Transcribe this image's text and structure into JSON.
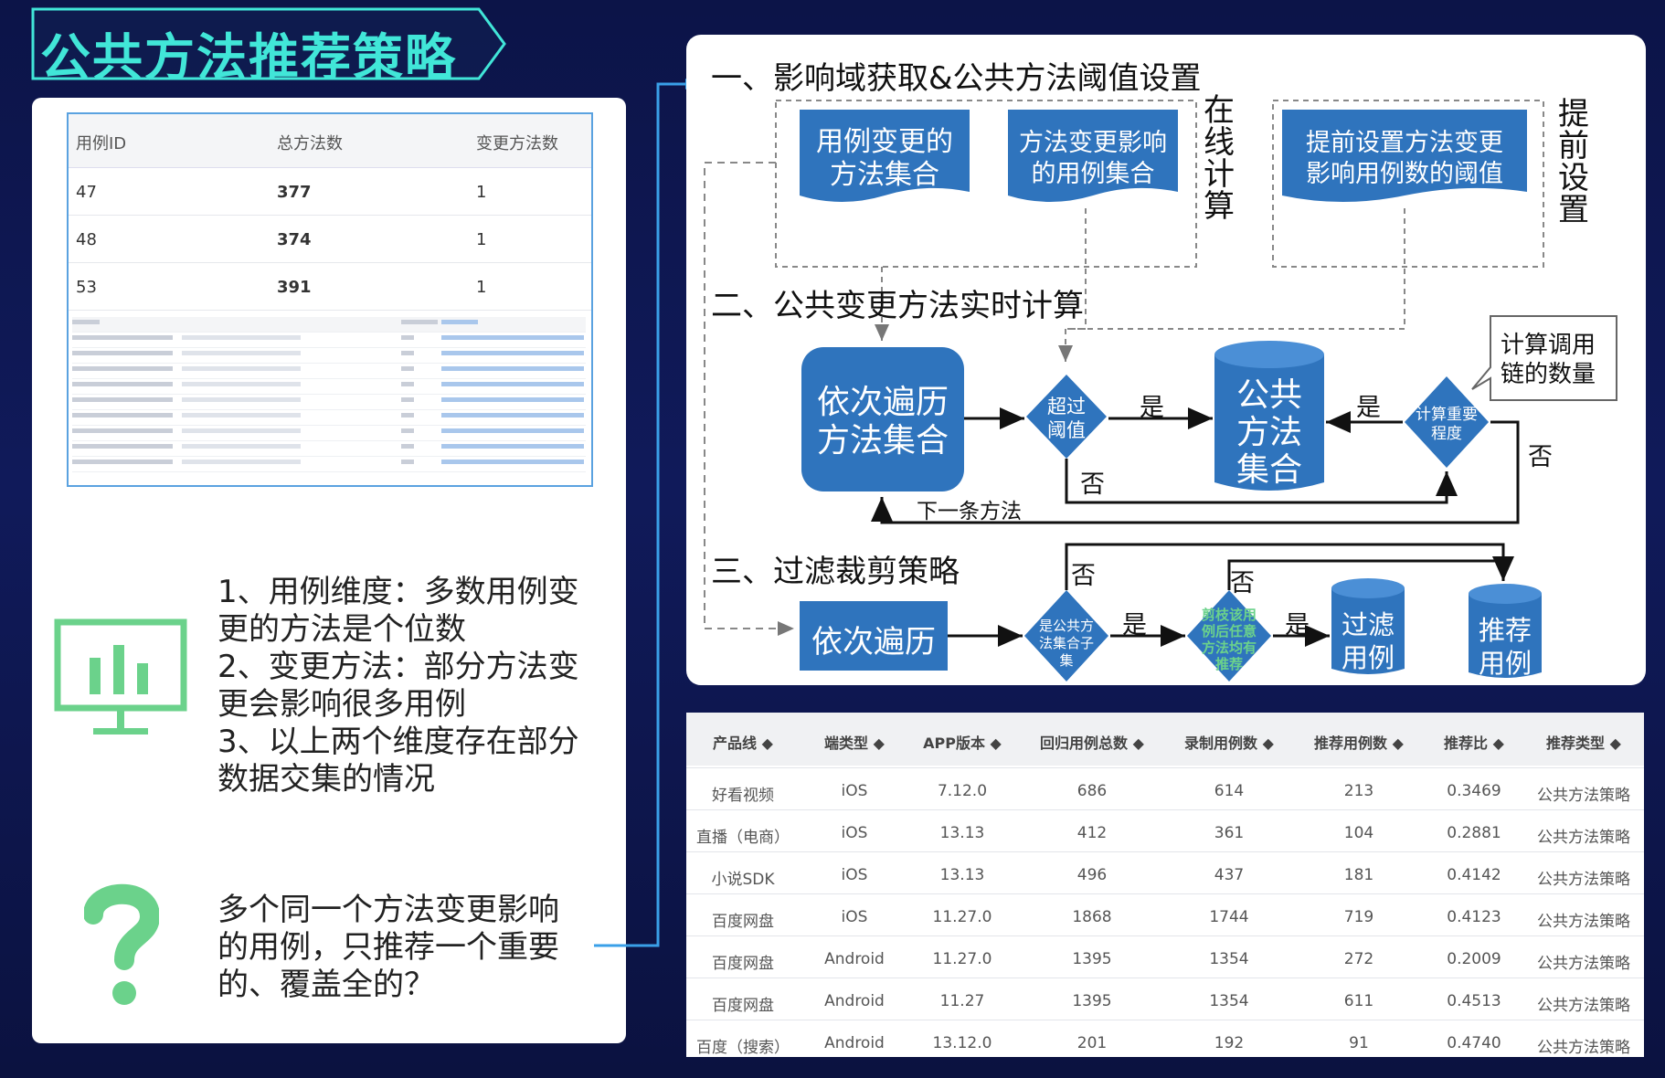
{
  "title": "公共方法推荐策略",
  "small_table": {
    "headers": [
      "用例ID",
      "总方法数",
      "变更方法数"
    ],
    "rows": [
      [
        "47",
        "377",
        "1"
      ],
      [
        "48",
        "374",
        "1"
      ],
      [
        "53",
        "391",
        "1"
      ]
    ]
  },
  "bullets": [
    "1、用例维度：多数用例变",
    "更的方法是个位数",
    "2、变更方法：部分方法变",
    "更会影响很多用例",
    "3、以上两个维度存在部分",
    "数据交集的情况"
  ],
  "question_lines": [
    "多个同一个方法变更影响",
    "的用例，只推荐一个重要",
    "的、覆盖全的？"
  ],
  "icons": {
    "chart": "monitor-chart-icon",
    "question": "question-mark-icon"
  },
  "colors": {
    "accent": "#41e6d8",
    "box_blue": "#2f74bd",
    "green": "#6bd28b"
  },
  "flow": {
    "section1": "一、影响域获取&公共方法阈值设置",
    "doc1_line1": "用例变更的",
    "doc1_line2": "方法集合",
    "doc2_line1": "方法变更影响",
    "doc2_line2": "的用例集合",
    "online": [
      "在",
      "线",
      "计",
      "算"
    ],
    "doc3_line1": "提前设置方法变更",
    "doc3_line2": "影响用例数的阈值",
    "preset": [
      "提",
      "前",
      "设",
      "置"
    ],
    "section2": "二、公共变更方法实时计算",
    "iter_line1": "依次遍历",
    "iter_line2": "方法集合",
    "exceed_line1": "超过",
    "exceed_line2": "阈值",
    "yes": "是",
    "no": "否",
    "cyl_lines": [
      "公共",
      "方法",
      "集合"
    ],
    "importance_line1": "计算重要",
    "importance_line2": "程度",
    "callout_line1": "计算调用",
    "callout_line2": "链的数量",
    "next_method": "下一条方法",
    "section3": "三、过滤裁剪策略",
    "iter2": "依次遍历",
    "subset_lines": [
      "是公共方",
      "法集合子",
      "集"
    ],
    "prune_lines": [
      "剪枝该用",
      "例后任意",
      "方法均有",
      "推荐"
    ],
    "filter_lines": [
      "过滤",
      "用例"
    ],
    "recommend_lines": [
      "推荐",
      "用例"
    ]
  },
  "data_table": {
    "headers": [
      "产品线 ◆",
      "端类型 ◆",
      "APP版本 ◆",
      "回归用例总数 ◆",
      "录制用例数 ◆",
      "推荐用例数 ◆",
      "推荐比 ◆",
      "推荐类型 ◆"
    ],
    "rows": [
      [
        "好看视频",
        "iOS",
        "7.12.0",
        "686",
        "614",
        "213",
        "0.3469",
        "公共方法策略"
      ],
      [
        "直播（电商）",
        "iOS",
        "13.13",
        "412",
        "361",
        "104",
        "0.2881",
        "公共方法策略"
      ],
      [
        "小说SDK",
        "iOS",
        "13.13",
        "496",
        "437",
        "181",
        "0.4142",
        "公共方法策略"
      ],
      [
        "百度网盘",
        "iOS",
        "11.27.0",
        "1868",
        "1744",
        "719",
        "0.4123",
        "公共方法策略"
      ],
      [
        "百度网盘",
        "Android",
        "11.27.0",
        "1395",
        "1354",
        "272",
        "0.2009",
        "公共方法策略"
      ],
      [
        "百度网盘",
        "Android",
        "11.27",
        "1395",
        "1354",
        "611",
        "0.4513",
        "公共方法策略"
      ],
      [
        "百度（搜索）",
        "Android",
        "13.12.0",
        "201",
        "192",
        "91",
        "0.4740",
        "公共方法策略"
      ]
    ]
  }
}
